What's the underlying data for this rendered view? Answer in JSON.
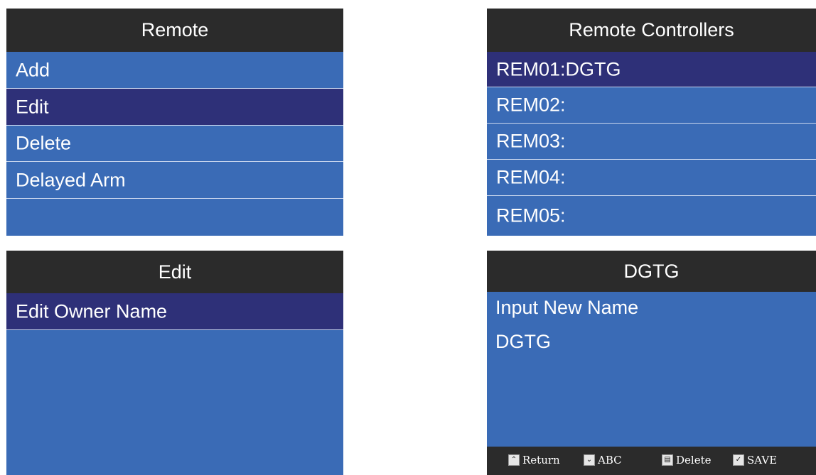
{
  "screens": {
    "remote": {
      "title": "Remote",
      "items": [
        "Add",
        "Edit",
        "Delete",
        "Delayed Arm",
        ""
      ],
      "selected_index": 1
    },
    "controllers": {
      "title": "Remote Controllers",
      "items": [
        "REM01:DGTG",
        "REM02:",
        "REM03:",
        "REM04:",
        "REM05:"
      ],
      "selected_index": 0
    },
    "edit": {
      "title": "Edit",
      "items": [
        "Edit Owner Name"
      ],
      "selected_index": 0
    },
    "rename": {
      "title": "DGTG",
      "prompt": "Input New Name",
      "value": "DGTG",
      "footer": {
        "return_label": "Return",
        "abc_label": "ABC",
        "delete_label": "Delete",
        "save_label": "SAVE"
      }
    }
  },
  "colors": {
    "screen_bg": "#3a6bb6",
    "selected_bg": "#2e3078",
    "title_bg": "#2b2b2b"
  }
}
